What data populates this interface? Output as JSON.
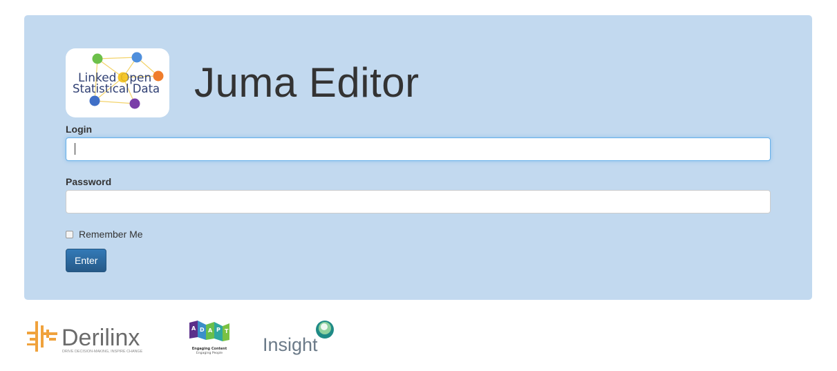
{
  "header": {
    "title": "Juma Editor",
    "logo": {
      "line1": "Linked Open",
      "line2": "Statistical Data"
    }
  },
  "form": {
    "login_label": "Login",
    "login_value": "",
    "password_label": "Password",
    "password_value": "",
    "remember_label": "Remember Me",
    "remember_checked": false,
    "submit_label": "Enter"
  },
  "footer": {
    "derilinx": {
      "name": "Derilinx",
      "tagline": "DRIVE DECISION-MAKING, INSPIRE CHANGE"
    },
    "adapt": {
      "letters": [
        "A",
        "D",
        "A",
        "P",
        "T"
      ],
      "line1": "Engaging Content",
      "line2": "Engaging People"
    },
    "insight": {
      "name": "Insight"
    }
  },
  "colors": {
    "panel_bg": "#c2d9ef",
    "button_bg": "#2d6ca2",
    "focus_border": "#66afe9"
  }
}
